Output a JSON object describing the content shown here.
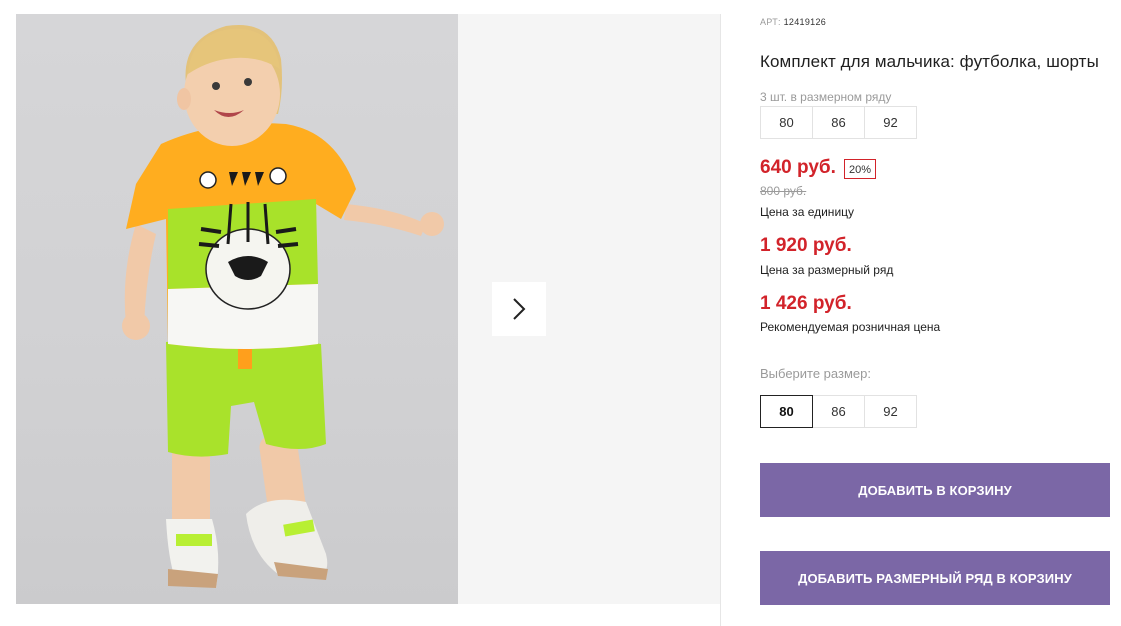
{
  "product": {
    "article_label": "АРТ:",
    "article_number": "12419126",
    "title": "Комплект для мальчика: футболка, шорты",
    "pack_note": "3 шт. в размерном ряду",
    "pack_sizes": [
      "80",
      "86",
      "92"
    ],
    "price_unit": "640 руб.",
    "discount_badge": "20%",
    "price_old": "800 руб.",
    "price_unit_caption": "Цена за единицу",
    "price_pack": "1 920 руб.",
    "price_pack_caption": "Цена за размерный ряд",
    "price_retail": "1 426 руб.",
    "price_retail_caption": "Рекомендуемая розничная цена",
    "choose_size_label": "Выберите размер:",
    "size_options": [
      "80",
      "86",
      "92"
    ],
    "selected_size": "80",
    "add_to_cart_label": "ДОБАВИТЬ В КОРЗИНУ",
    "add_pack_to_cart_label": "ДОБАВИТЬ РАЗМЕРНЫЙ РЯД В КОРЗИНУ"
  },
  "gallery": {
    "next_icon": "chevron-right-icon"
  },
  "colors": {
    "price_red": "#d2232a",
    "button_purple": "#7b67a6",
    "shirt_orange": "#ffad1f",
    "shirt_green": "#a8e22a",
    "shorts_green": "#a9e22b"
  }
}
